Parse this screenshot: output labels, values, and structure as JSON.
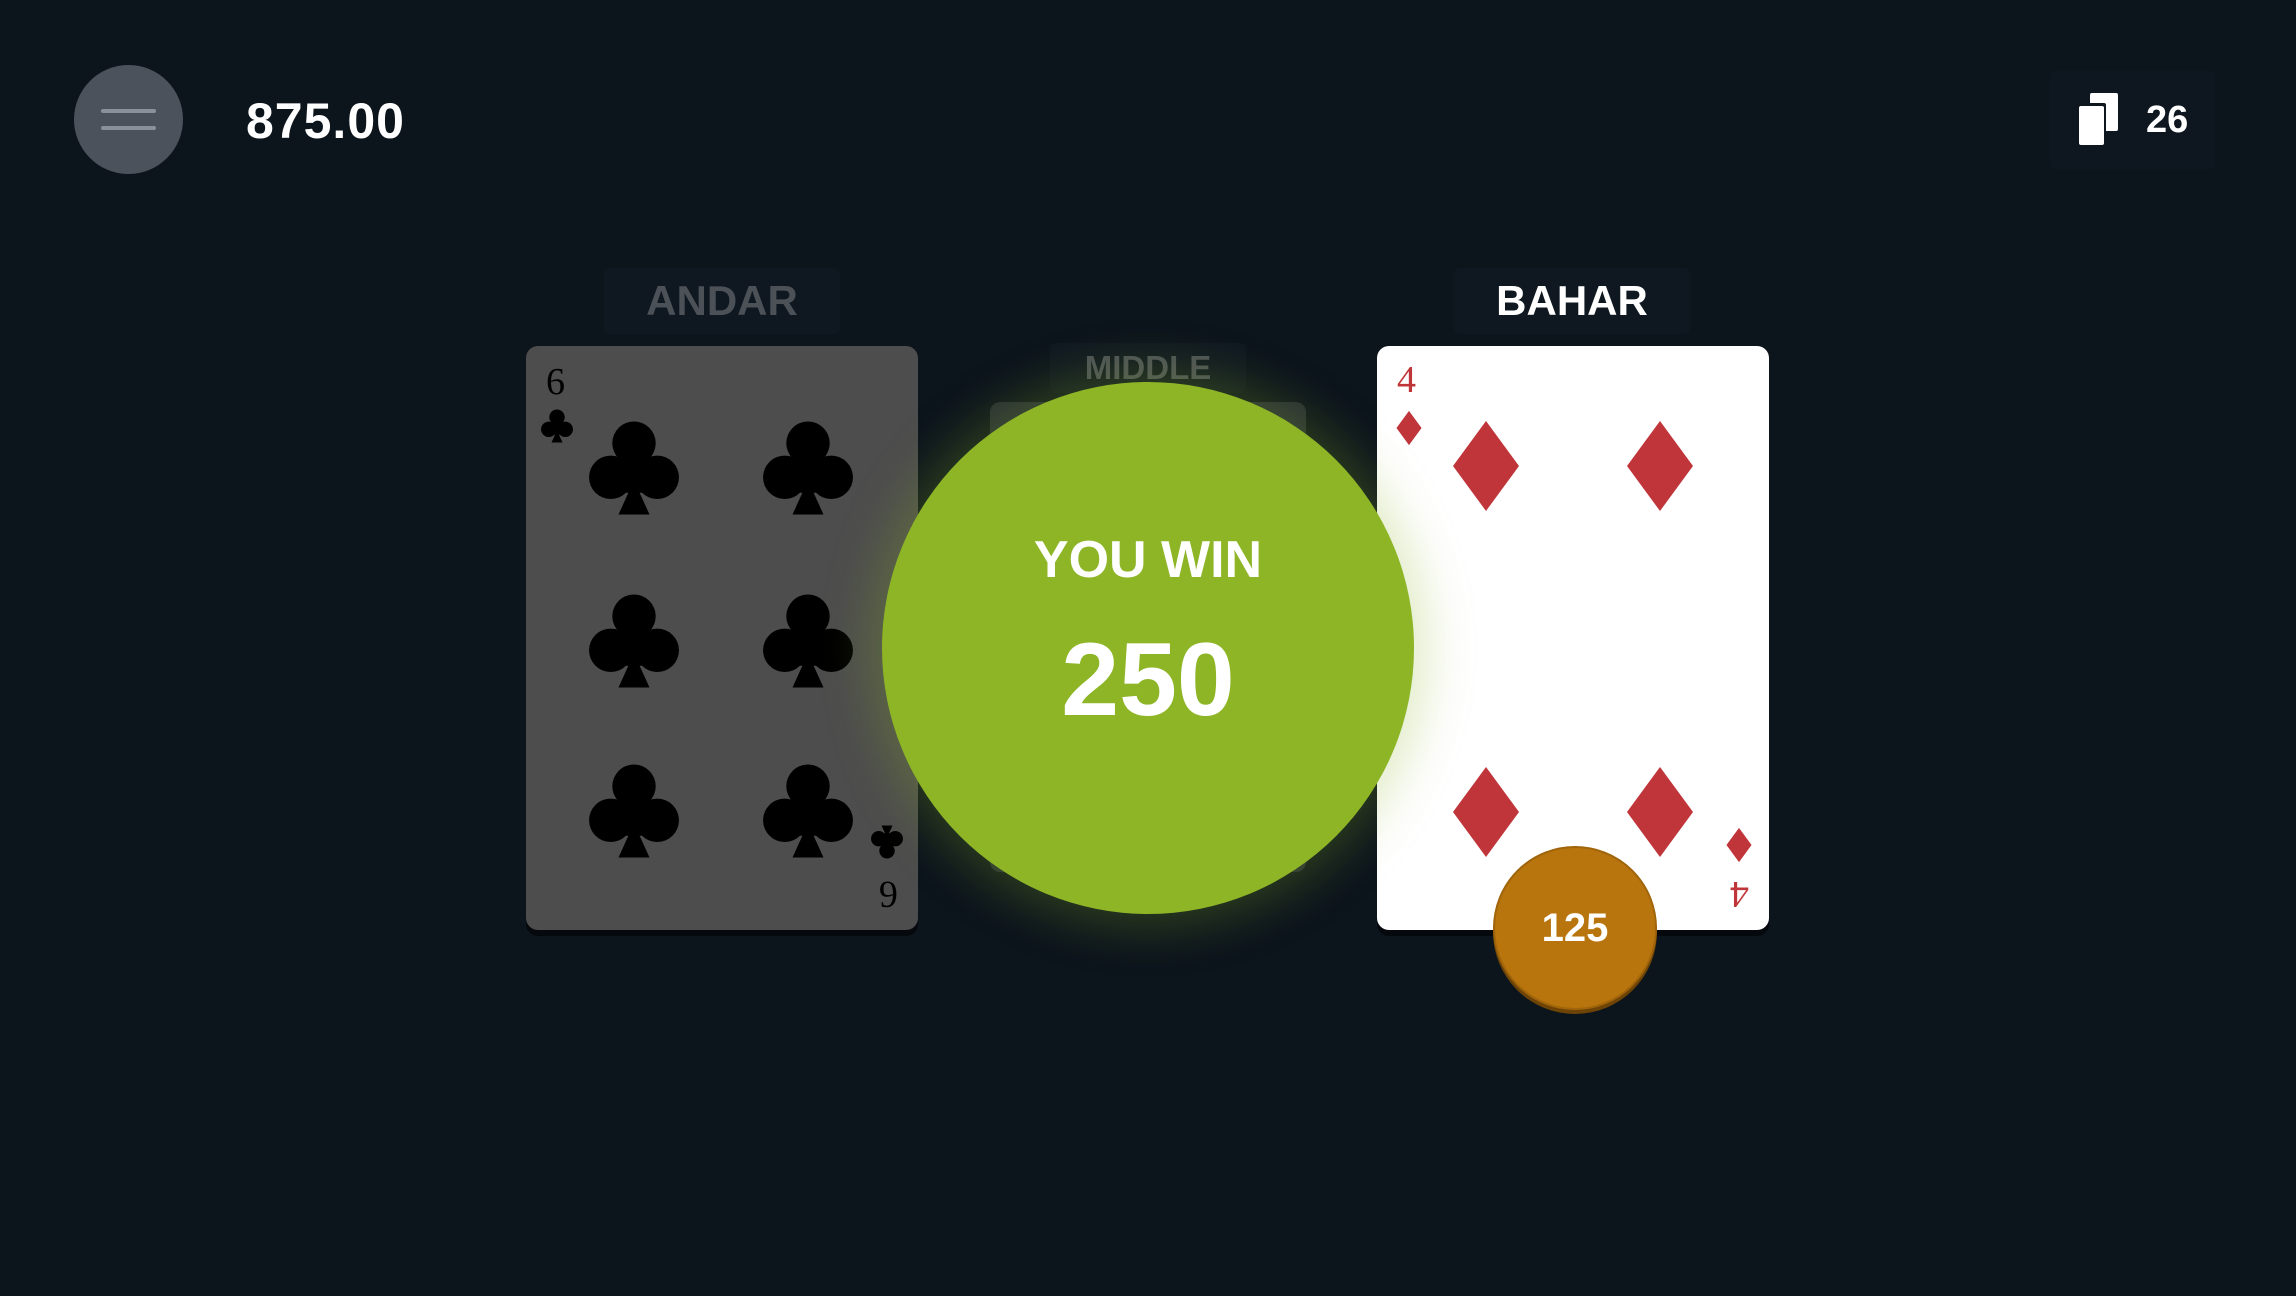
{
  "header": {
    "menu_icon": "hamburger-menu-icon",
    "balance": "875.00",
    "deck_icon": "cards-stack-icon",
    "deck_count": "26"
  },
  "table": {
    "andar_label": "ANDAR",
    "middle_label": "MIDDLE",
    "bahar_label": "BAHAR"
  },
  "cards": {
    "andar": {
      "rank": "6",
      "suit": "clubs",
      "color": "#000000",
      "dimmed": true
    },
    "bahar": {
      "rank": "4",
      "suit": "diamonds",
      "color": "#c0353a",
      "dimmed": false
    }
  },
  "result": {
    "title": "YOU WIN",
    "amount": "250",
    "color": "#8db526"
  },
  "bet_chip": {
    "amount": "125",
    "color": "#b8740d"
  }
}
